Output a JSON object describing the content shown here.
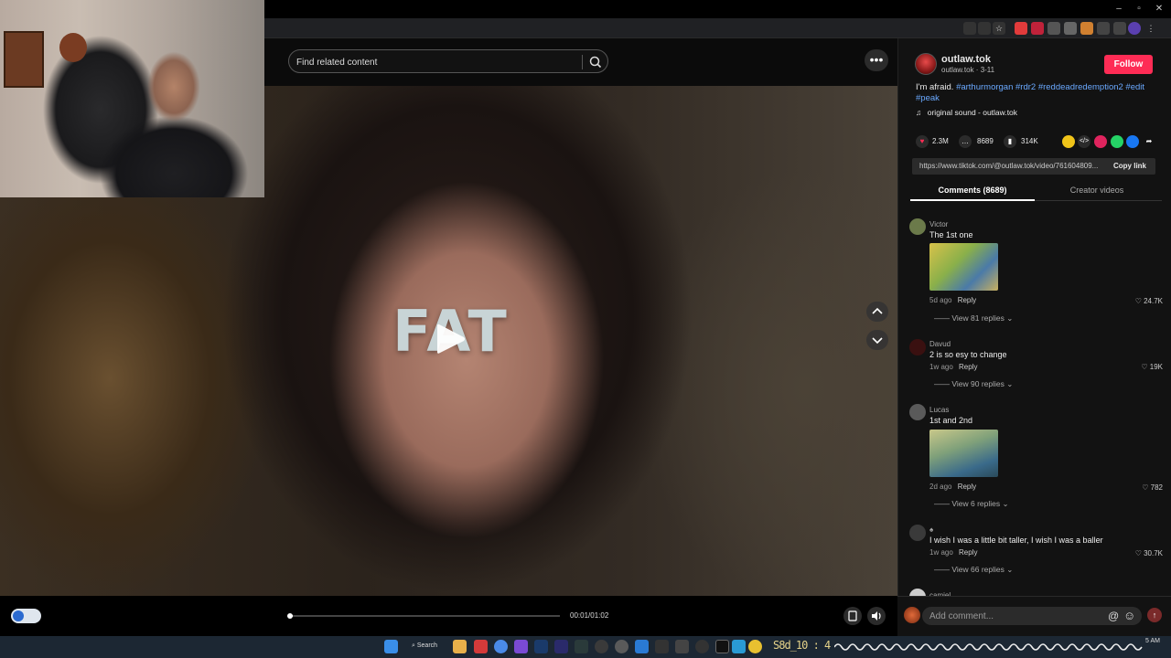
{
  "browser": {
    "window_controls": [
      "–",
      "▫",
      "✕"
    ]
  },
  "search": {
    "placeholder": "Find related content"
  },
  "video": {
    "overlay_text": "FAT",
    "current_time": "00:01/01:02",
    "progress_fraction": 0.015
  },
  "author": {
    "display_name": "outlaw.tok",
    "handle_date": "outlaw.tok · 3-11",
    "follow_label": "Follow"
  },
  "caption": {
    "text_plain": "I'm afraid.",
    "hashtags": "#arthurmorgan #rdr2 #reddeadredemption2 #edit",
    "hashtags_line2": "#peak",
    "sound": "original sound - outlaw.tok"
  },
  "stats": {
    "likes": "2.3M",
    "comments": "8689",
    "saves": "314K"
  },
  "share": {
    "url": "https://www.tiktok.com/@outlaw.tok/video/761604809...",
    "copy_label": "Copy link"
  },
  "tabs": {
    "comments": "Comments (8689)",
    "creator_videos": "Creator videos"
  },
  "comments": [
    {
      "name": "Victor",
      "text": "The 1st one",
      "meta_time": "5d ago",
      "reply": "Reply",
      "likes": "24.7K",
      "replies": "View 81 replies"
    },
    {
      "name": "Davud",
      "text": "2 is so esy to change",
      "meta_time": "1w ago",
      "reply": "Reply",
      "likes": "19K",
      "replies": "View 90 replies"
    },
    {
      "name": "Lucas",
      "text": "1st and 2nd",
      "meta_time": "2d ago",
      "reply": "Reply",
      "likes": "782",
      "replies": "View 6 replies"
    },
    {
      "name": "♠",
      "text": "I wish I was a little bit taller, I wish I was a baller",
      "meta_time": "1w ago",
      "reply": "Reply",
      "likes": "30.7K",
      "replies": "View 66 replies"
    },
    {
      "name": "camiel"
    }
  ],
  "comment_box": {
    "placeholder": "Add comment..."
  },
  "taskbar": {
    "search_label": "Search",
    "ticker": "S8d_10 : 4",
    "time": "5 AM"
  },
  "colors": {
    "accent": "#fe2c55",
    "link": "#6aa9ff",
    "panel_bg": "#121212"
  }
}
